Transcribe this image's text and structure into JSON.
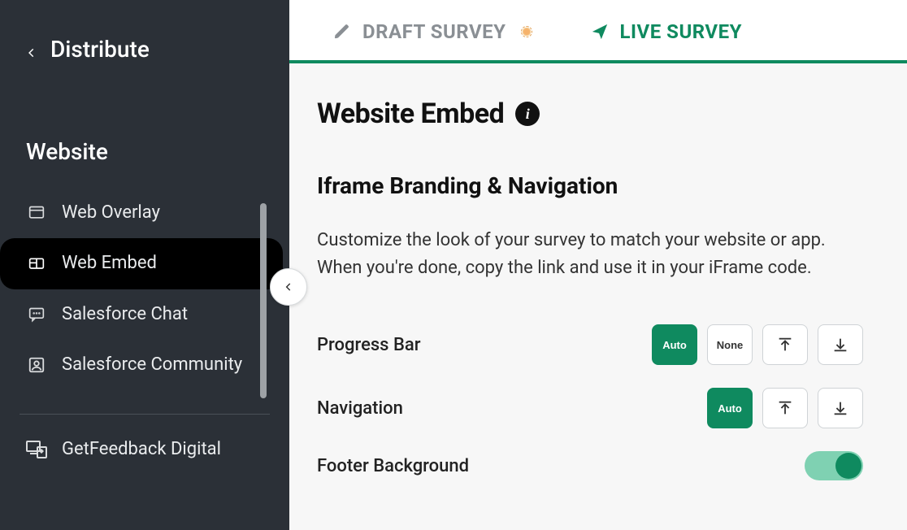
{
  "sidebar": {
    "back_label": "Distribute",
    "section_title": "Website",
    "items": [
      {
        "label": "Web Overlay"
      },
      {
        "label": "Web Embed"
      },
      {
        "label": "Salesforce Chat"
      },
      {
        "label": "Salesforce Community"
      }
    ],
    "digital_label": "GetFeedback Digital"
  },
  "tabs": {
    "draft_label": "DRAFT SURVEY",
    "live_label": "LIVE SURVEY"
  },
  "page": {
    "title": "Website Embed",
    "section_heading": "Iframe Branding & Navigation",
    "section_desc": "Customize the look of your survey to match your website or app. When you're done, copy the link and use it in your iFrame code.",
    "progress_bar": {
      "label": "Progress Bar",
      "auto": "Auto",
      "none": "None"
    },
    "navigation": {
      "label": "Navigation",
      "auto": "Auto"
    },
    "footer_background": {
      "label": "Footer Background"
    }
  }
}
